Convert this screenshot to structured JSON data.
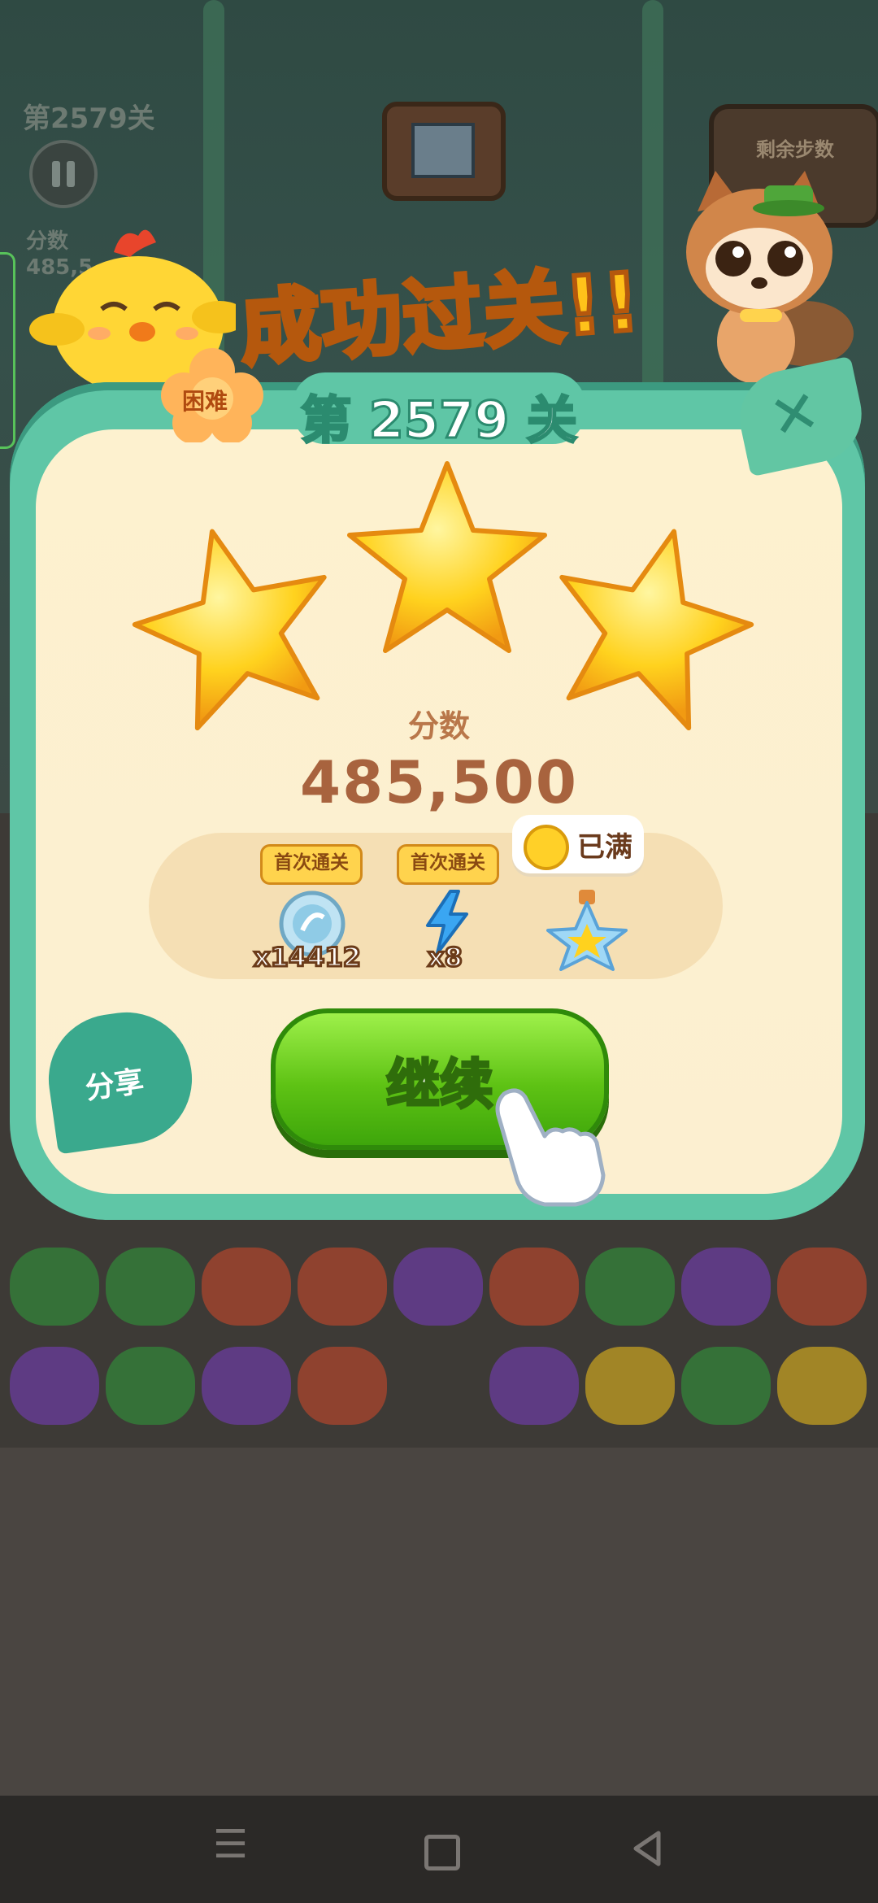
{
  "hud": {
    "level_label": "第2579关",
    "score_label": "分数",
    "score_value": "485,5",
    "moves_label": "剩余步数",
    "pause_icon": "pause-icon"
  },
  "dialog": {
    "title": "成功过关!!",
    "level_text": "第 2579 关",
    "difficulty_label": "困难",
    "close_icon": "close-icon",
    "stars_earned": 3,
    "stars_total": 3,
    "score_label": "分数",
    "score_value": "485,500",
    "rewards": [
      {
        "tag": "首次通关",
        "icon": "coin-icon",
        "count": "x14412"
      },
      {
        "tag": "首次通关",
        "icon": "lightning-icon",
        "count": "x8"
      },
      {
        "icon": "star-bottle-icon",
        "bubble_text": "已满"
      }
    ],
    "continue_label": "继续",
    "share_label": "分享"
  },
  "board": {
    "row1": [
      "frog",
      "frog",
      "fox",
      "fox",
      "owl",
      "fox",
      "frog",
      "owl",
      "fox"
    ],
    "row2": [
      "owl",
      "frog",
      "owl",
      "fox",
      "",
      "owl",
      "chick",
      "frog",
      "chick"
    ]
  },
  "colors": {
    "frog": "#2f9e3a",
    "fox": "#d4482a",
    "owl": "#7a3cc2",
    "chick": "#f4c21a",
    "accent_green": "#5ec214",
    "leaf_teal": "#5fc6a6"
  },
  "nav": {
    "menu_icon": "menu-icon",
    "home_icon": "home-icon",
    "back_icon": "back-icon"
  }
}
